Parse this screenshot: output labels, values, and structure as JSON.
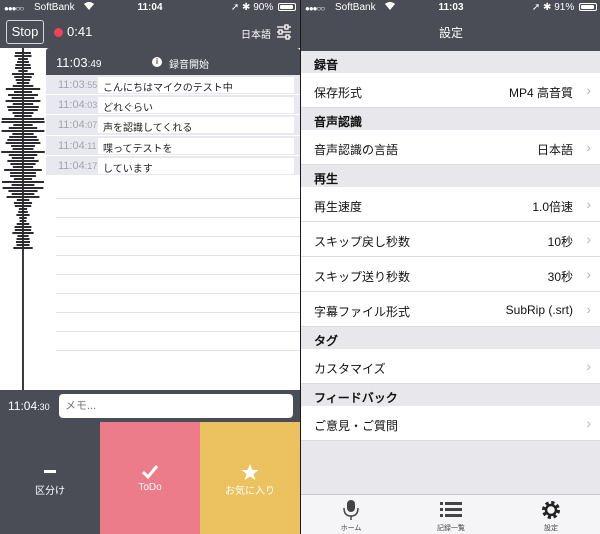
{
  "left": {
    "status": {
      "carrier": "SoftBank",
      "time": "11:04",
      "battery": "90%",
      "battery_level": 0.9
    },
    "toolbar": {
      "stop_label": "Stop",
      "elapsed": "0:41",
      "language": "日本語"
    },
    "log": {
      "header": {
        "time_main": "11:03",
        "time_sec": ":49",
        "message": "録音開始"
      },
      "entries": [
        {
          "time_main": "11:03",
          "time_sec": ":55",
          "text": "こんにちはマイクのテスト中"
        },
        {
          "time_main": "11:04",
          "time_sec": ":03",
          "text": "どれぐらい"
        },
        {
          "time_main": "11:04",
          "time_sec": ":07",
          "text": "声を認識してくれる"
        },
        {
          "time_main": "11:04",
          "time_sec": ":11",
          "text": "喋ってテストを"
        },
        {
          "time_main": "11:04",
          "time_sec": ":17",
          "text": "しています"
        }
      ]
    },
    "memo": {
      "time_main": "11:04",
      "time_sec": ":30",
      "placeholder": "メモ..."
    },
    "actions": {
      "separator": "区分け",
      "todo": "ToDo",
      "favorite": "お気に入り"
    },
    "colors": {
      "dark": "#4a4c56",
      "record": "#f0425a",
      "todo": "#ed7c8b",
      "favorite": "#ecc15f"
    }
  },
  "right": {
    "status": {
      "carrier": "SoftBank",
      "time": "11:03",
      "battery": "91%",
      "battery_level": 0.91
    },
    "title": "設定",
    "sections": {
      "recording": {
        "title": "録音",
        "rows": [
          {
            "label": "保存形式",
            "value": "MP4 高音質"
          }
        ]
      },
      "speech": {
        "title": "音声認識",
        "rows": [
          {
            "label": "音声認識の言語",
            "value": "日本語"
          }
        ]
      },
      "playback": {
        "title": "再生",
        "rows": [
          {
            "label": "再生速度",
            "value": "1.0倍速"
          },
          {
            "label": "スキップ戻し秒数",
            "value": "10秒"
          },
          {
            "label": "スキップ送り秒数",
            "value": "30秒"
          },
          {
            "label": "字幕ファイル形式",
            "value": "SubRip (.srt)"
          }
        ]
      },
      "tag": {
        "title": "タグ",
        "rows": [
          {
            "label": "カスタマイズ",
            "value": ""
          }
        ]
      },
      "feedback": {
        "title": "フィードバック",
        "rows": [
          {
            "label": "ご意見・ご質問",
            "value": ""
          }
        ]
      }
    },
    "tabs": {
      "home": "ホーム",
      "list": "記録一覧",
      "settings": "設定"
    }
  }
}
